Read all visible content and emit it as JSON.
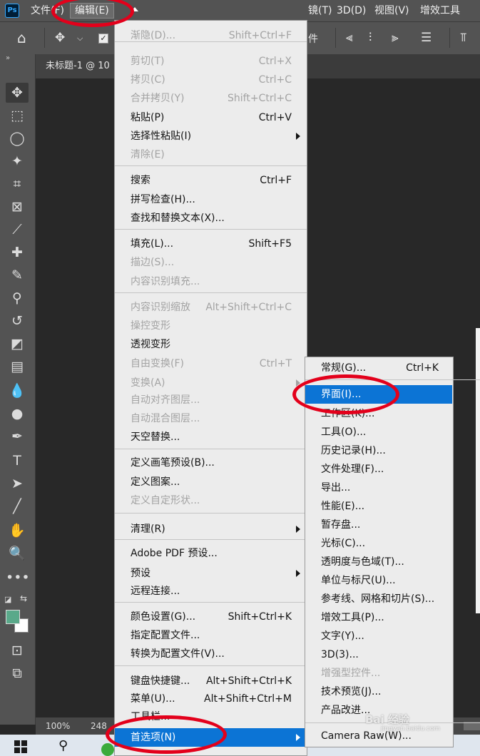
{
  "app": {
    "logo_text": "Ps",
    "menu": [
      {
        "label": "文件(F)",
        "id": "file"
      },
      {
        "label": "编辑(E)",
        "id": "edit"
      },
      {
        "label": "镜(T)",
        "id": "filter"
      },
      {
        "label": "3D(D)",
        "id": "3d"
      },
      {
        "label": "视图(V)",
        "id": "view"
      },
      {
        "label": "增效工具",
        "id": "plugins"
      }
    ]
  },
  "options_bar": {
    "text_partial": "件",
    "icons": [
      "home-icon",
      "move-icon",
      "checkbox-icon",
      "align-left-icon",
      "align-center-icon",
      "align-right-icon",
      "distribute-icon",
      "align-top-icon"
    ]
  },
  "document": {
    "tab_label": "未标题-1 @ 10",
    "zoom": "100%",
    "size_partial": "248"
  },
  "toolbar": {
    "collapse": "»",
    "tools": [
      {
        "name": "move-tool",
        "glyph": "✥",
        "selected": true
      },
      {
        "name": "marquee-tool",
        "glyph": "⬚"
      },
      {
        "name": "lasso-tool",
        "glyph": "◯"
      },
      {
        "name": "magic-wand-tool",
        "glyph": "✦"
      },
      {
        "name": "crop-tool",
        "glyph": "⌗"
      },
      {
        "name": "frame-tool",
        "glyph": "⊠"
      },
      {
        "name": "eyedropper-tool",
        "glyph": "⟋"
      },
      {
        "name": "healing-brush-tool",
        "glyph": "✚"
      },
      {
        "name": "brush-tool",
        "glyph": "✎"
      },
      {
        "name": "clone-stamp-tool",
        "glyph": "⚲"
      },
      {
        "name": "history-brush-tool",
        "glyph": "↺"
      },
      {
        "name": "eraser-tool",
        "glyph": "◩"
      },
      {
        "name": "gradient-tool",
        "glyph": "▤"
      },
      {
        "name": "blur-tool",
        "glyph": "💧"
      },
      {
        "name": "dodge-tool",
        "glyph": "●"
      },
      {
        "name": "pen-tool",
        "glyph": "✒"
      },
      {
        "name": "type-tool",
        "glyph": "T"
      },
      {
        "name": "path-selection-tool",
        "glyph": "➤"
      },
      {
        "name": "line-tool",
        "glyph": "╱"
      },
      {
        "name": "hand-tool",
        "glyph": "✋"
      },
      {
        "name": "zoom-tool",
        "glyph": "🔍"
      },
      {
        "name": "more-tools",
        "glyph": "•••"
      }
    ],
    "quick_mask_glyph": "⊡",
    "screen_mode_glyph": "⧉",
    "fg_color": "#5aa98a",
    "bg_color": "#ffffff"
  },
  "edit_menu": {
    "items": [
      {
        "label": "渐隐(D)...",
        "shortcut": "Shift+Ctrl+F",
        "disabled": true
      },
      {
        "sep": true
      },
      {
        "label": "剪切(T)",
        "shortcut": "Ctrl+X",
        "disabled": true
      },
      {
        "label": "拷贝(C)",
        "shortcut": "Ctrl+C",
        "disabled": true
      },
      {
        "label": "合并拷贝(Y)",
        "shortcut": "Shift+Ctrl+C",
        "disabled": true
      },
      {
        "label": "粘贴(P)",
        "shortcut": "Ctrl+V"
      },
      {
        "label": "选择性粘贴(I)",
        "submenu": true
      },
      {
        "label": "清除(E)",
        "disabled": true
      },
      {
        "sep": true
      },
      {
        "label": "搜索",
        "shortcut": "Ctrl+F"
      },
      {
        "label": "拼写检查(H)..."
      },
      {
        "label": "查找和替换文本(X)..."
      },
      {
        "sep": true
      },
      {
        "label": "填充(L)...",
        "shortcut": "Shift+F5"
      },
      {
        "label": "描边(S)...",
        "disabled": true
      },
      {
        "label": "内容识别填充...",
        "disabled": true
      },
      {
        "sep": true
      },
      {
        "label": "内容识别缩放",
        "shortcut": "Alt+Shift+Ctrl+C",
        "disabled": true
      },
      {
        "label": "操控变形",
        "disabled": true
      },
      {
        "label": "透视变形"
      },
      {
        "label": "自由变换(F)",
        "shortcut": "Ctrl+T",
        "disabled": true
      },
      {
        "label": "变换(A)",
        "submenu": true,
        "disabled": true
      },
      {
        "label": "自动对齐图层...",
        "disabled": true
      },
      {
        "label": "自动混合图层...",
        "disabled": true
      },
      {
        "label": "天空替换..."
      },
      {
        "sep": true
      },
      {
        "label": "定义画笔预设(B)..."
      },
      {
        "label": "定义图案..."
      },
      {
        "label": "定义自定形状...",
        "disabled": true
      },
      {
        "sep": true
      },
      {
        "label": "清理(R)",
        "submenu": true
      },
      {
        "sep": true
      },
      {
        "label": "Adobe PDF 预设..."
      },
      {
        "label": "预设",
        "submenu": true
      },
      {
        "label": "远程连接..."
      },
      {
        "sep": true
      },
      {
        "label": "颜色设置(G)...",
        "shortcut": "Shift+Ctrl+K"
      },
      {
        "label": "指定配置文件..."
      },
      {
        "label": "转换为配置文件(V)..."
      },
      {
        "sep": true
      },
      {
        "label": "键盘快捷键...",
        "shortcut": "Alt+Shift+Ctrl+K"
      },
      {
        "label": "菜单(U)...",
        "shortcut": "Alt+Shift+Ctrl+M"
      },
      {
        "label": "工具栏..."
      },
      {
        "label": "首选项(N)",
        "submenu": true,
        "highlight": true
      }
    ]
  },
  "preferences_menu": {
    "items": [
      {
        "label": "常规(G)...",
        "shortcut": "Ctrl+K"
      },
      {
        "sep": true
      },
      {
        "label": "界面(I)...",
        "highlight": true
      },
      {
        "label": "工作区(K)..."
      },
      {
        "label": "工具(O)..."
      },
      {
        "label": "历史记录(H)..."
      },
      {
        "label": "文件处理(F)..."
      },
      {
        "label": "导出..."
      },
      {
        "label": "性能(E)..."
      },
      {
        "label": "暂存盘..."
      },
      {
        "label": "光标(C)..."
      },
      {
        "label": "透明度与色域(T)..."
      },
      {
        "label": "单位与标尺(U)..."
      },
      {
        "label": "参考线、网格和切片(S)..."
      },
      {
        "label": "增效工具(P)..."
      },
      {
        "label": "文字(Y)..."
      },
      {
        "label": "3D(3)..."
      },
      {
        "label": "增强型控件...",
        "disabled": true
      },
      {
        "label": "技术预览(J)..."
      },
      {
        "label": "产品改进..."
      },
      {
        "sep": true
      },
      {
        "label": "Camera Raw(W)..."
      }
    ]
  },
  "watermark": {
    "text": "Bai 经验",
    "sub": "jingyan.baidu.com"
  }
}
